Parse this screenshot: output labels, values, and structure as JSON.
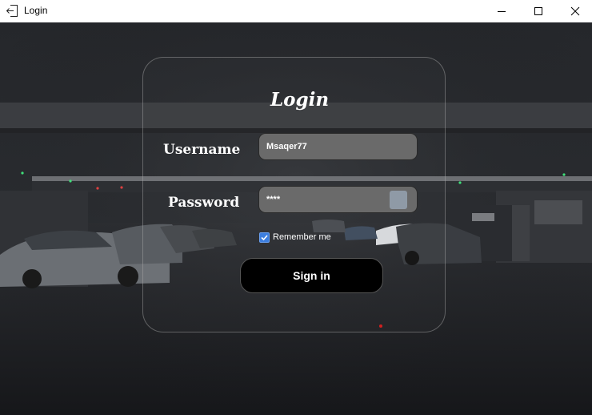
{
  "window": {
    "title": "Login",
    "icon": "sign-out-icon",
    "controls": [
      "minimize-icon",
      "maximize-icon",
      "close-icon"
    ]
  },
  "login": {
    "heading": "Login",
    "username_label": "Username",
    "username_value": "Msaqer77",
    "password_label": "Password",
    "password_value": "****",
    "remember_label": "Remember me",
    "remember_checked": true,
    "signin_label": "Sign in"
  },
  "colors": {
    "field_bg": "#6a6a6a",
    "button_bg": "#000000",
    "checkbox": "#3d7fe0"
  }
}
